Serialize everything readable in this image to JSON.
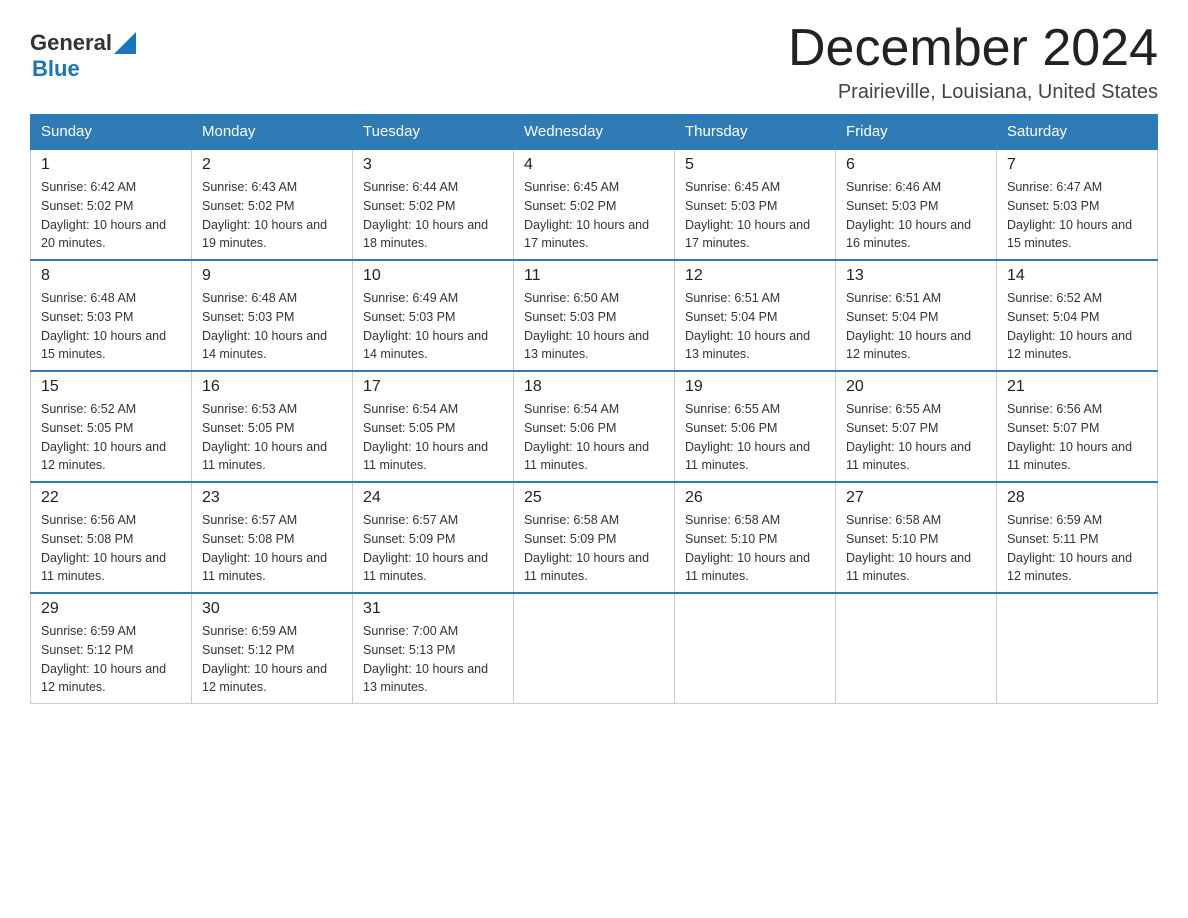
{
  "header": {
    "logo_general": "General",
    "logo_blue": "Blue",
    "month_title": "December 2024",
    "location": "Prairieville, Louisiana, United States"
  },
  "days_of_week": [
    "Sunday",
    "Monday",
    "Tuesday",
    "Wednesday",
    "Thursday",
    "Friday",
    "Saturday"
  ],
  "weeks": [
    [
      {
        "day": "1",
        "sunrise": "6:42 AM",
        "sunset": "5:02 PM",
        "daylight": "10 hours and 20 minutes."
      },
      {
        "day": "2",
        "sunrise": "6:43 AM",
        "sunset": "5:02 PM",
        "daylight": "10 hours and 19 minutes."
      },
      {
        "day": "3",
        "sunrise": "6:44 AM",
        "sunset": "5:02 PM",
        "daylight": "10 hours and 18 minutes."
      },
      {
        "day": "4",
        "sunrise": "6:45 AM",
        "sunset": "5:02 PM",
        "daylight": "10 hours and 17 minutes."
      },
      {
        "day": "5",
        "sunrise": "6:45 AM",
        "sunset": "5:03 PM",
        "daylight": "10 hours and 17 minutes."
      },
      {
        "day": "6",
        "sunrise": "6:46 AM",
        "sunset": "5:03 PM",
        "daylight": "10 hours and 16 minutes."
      },
      {
        "day": "7",
        "sunrise": "6:47 AM",
        "sunset": "5:03 PM",
        "daylight": "10 hours and 15 minutes."
      }
    ],
    [
      {
        "day": "8",
        "sunrise": "6:48 AM",
        "sunset": "5:03 PM",
        "daylight": "10 hours and 15 minutes."
      },
      {
        "day": "9",
        "sunrise": "6:48 AM",
        "sunset": "5:03 PM",
        "daylight": "10 hours and 14 minutes."
      },
      {
        "day": "10",
        "sunrise": "6:49 AM",
        "sunset": "5:03 PM",
        "daylight": "10 hours and 14 minutes."
      },
      {
        "day": "11",
        "sunrise": "6:50 AM",
        "sunset": "5:03 PM",
        "daylight": "10 hours and 13 minutes."
      },
      {
        "day": "12",
        "sunrise": "6:51 AM",
        "sunset": "5:04 PM",
        "daylight": "10 hours and 13 minutes."
      },
      {
        "day": "13",
        "sunrise": "6:51 AM",
        "sunset": "5:04 PM",
        "daylight": "10 hours and 12 minutes."
      },
      {
        "day": "14",
        "sunrise": "6:52 AM",
        "sunset": "5:04 PM",
        "daylight": "10 hours and 12 minutes."
      }
    ],
    [
      {
        "day": "15",
        "sunrise": "6:52 AM",
        "sunset": "5:05 PM",
        "daylight": "10 hours and 12 minutes."
      },
      {
        "day": "16",
        "sunrise": "6:53 AM",
        "sunset": "5:05 PM",
        "daylight": "10 hours and 11 minutes."
      },
      {
        "day": "17",
        "sunrise": "6:54 AM",
        "sunset": "5:05 PM",
        "daylight": "10 hours and 11 minutes."
      },
      {
        "day": "18",
        "sunrise": "6:54 AM",
        "sunset": "5:06 PM",
        "daylight": "10 hours and 11 minutes."
      },
      {
        "day": "19",
        "sunrise": "6:55 AM",
        "sunset": "5:06 PM",
        "daylight": "10 hours and 11 minutes."
      },
      {
        "day": "20",
        "sunrise": "6:55 AM",
        "sunset": "5:07 PM",
        "daylight": "10 hours and 11 minutes."
      },
      {
        "day": "21",
        "sunrise": "6:56 AM",
        "sunset": "5:07 PM",
        "daylight": "10 hours and 11 minutes."
      }
    ],
    [
      {
        "day": "22",
        "sunrise": "6:56 AM",
        "sunset": "5:08 PM",
        "daylight": "10 hours and 11 minutes."
      },
      {
        "day": "23",
        "sunrise": "6:57 AM",
        "sunset": "5:08 PM",
        "daylight": "10 hours and 11 minutes."
      },
      {
        "day": "24",
        "sunrise": "6:57 AM",
        "sunset": "5:09 PM",
        "daylight": "10 hours and 11 minutes."
      },
      {
        "day": "25",
        "sunrise": "6:58 AM",
        "sunset": "5:09 PM",
        "daylight": "10 hours and 11 minutes."
      },
      {
        "day": "26",
        "sunrise": "6:58 AM",
        "sunset": "5:10 PM",
        "daylight": "10 hours and 11 minutes."
      },
      {
        "day": "27",
        "sunrise": "6:58 AM",
        "sunset": "5:10 PM",
        "daylight": "10 hours and 11 minutes."
      },
      {
        "day": "28",
        "sunrise": "6:59 AM",
        "sunset": "5:11 PM",
        "daylight": "10 hours and 12 minutes."
      }
    ],
    [
      {
        "day": "29",
        "sunrise": "6:59 AM",
        "sunset": "5:12 PM",
        "daylight": "10 hours and 12 minutes."
      },
      {
        "day": "30",
        "sunrise": "6:59 AM",
        "sunset": "5:12 PM",
        "daylight": "10 hours and 12 minutes."
      },
      {
        "day": "31",
        "sunrise": "7:00 AM",
        "sunset": "5:13 PM",
        "daylight": "10 hours and 13 minutes."
      },
      null,
      null,
      null,
      null
    ]
  ]
}
